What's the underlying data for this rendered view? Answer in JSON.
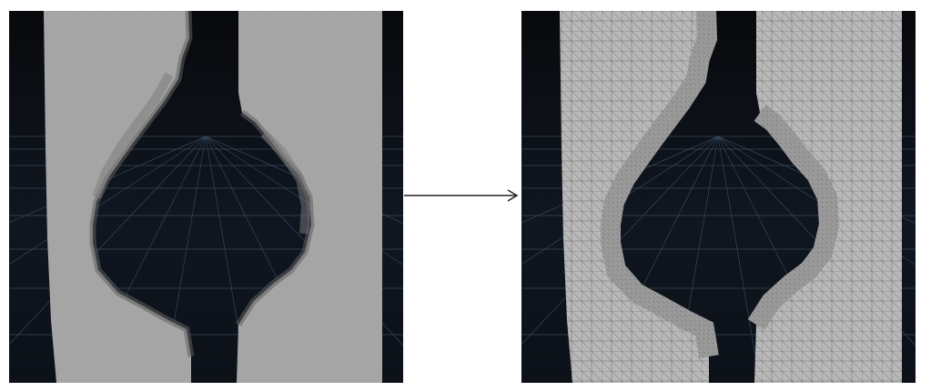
{
  "viewports": [
    {
      "id": "left",
      "mesh": "dense-uniform"
    },
    {
      "id": "right",
      "mesh": "adaptive-triangulated"
    }
  ],
  "colors": {
    "background": "#ffffff",
    "viewport_bg": "#0b0c0f",
    "grid": "#3a4a5a",
    "mesh_surface": "#a3a3a3",
    "mesh_shadow": "#6a6a6a",
    "wireframe": "#5a5a5a",
    "arrow": "#222222"
  },
  "icons": [
    "arrow-right-icon"
  ]
}
